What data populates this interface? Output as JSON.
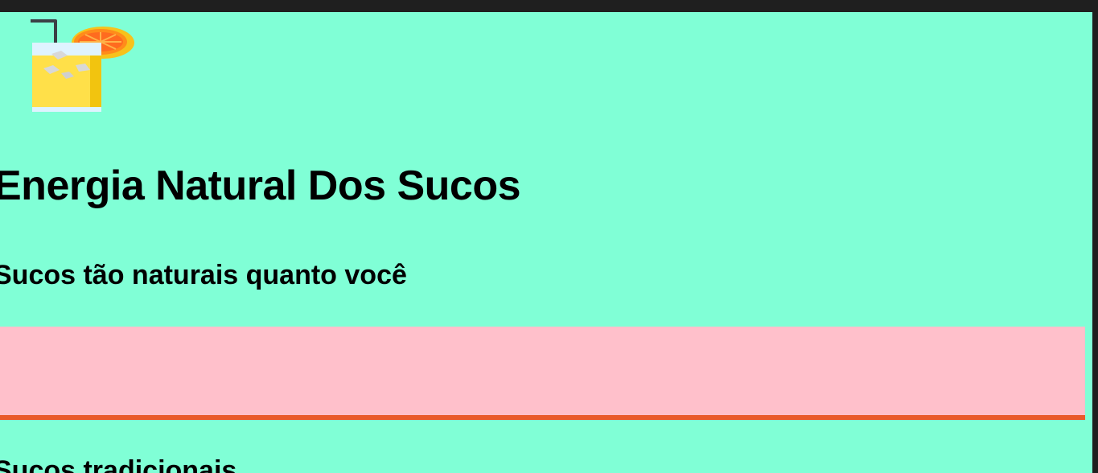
{
  "header": {
    "logo_icon": "juice-glass-with-orange-slice-icon",
    "title": "Energia Natural Dos Sucos",
    "subtitle": "Sucos tão naturais quanto você"
  },
  "banner": {
    "background": "#ffc0cb",
    "border_color": "#e95a2b"
  },
  "section": {
    "title": "Sucos tradicionais"
  },
  "colors": {
    "page_background": "#80ffd6",
    "chrome": "#1f1f1f"
  }
}
